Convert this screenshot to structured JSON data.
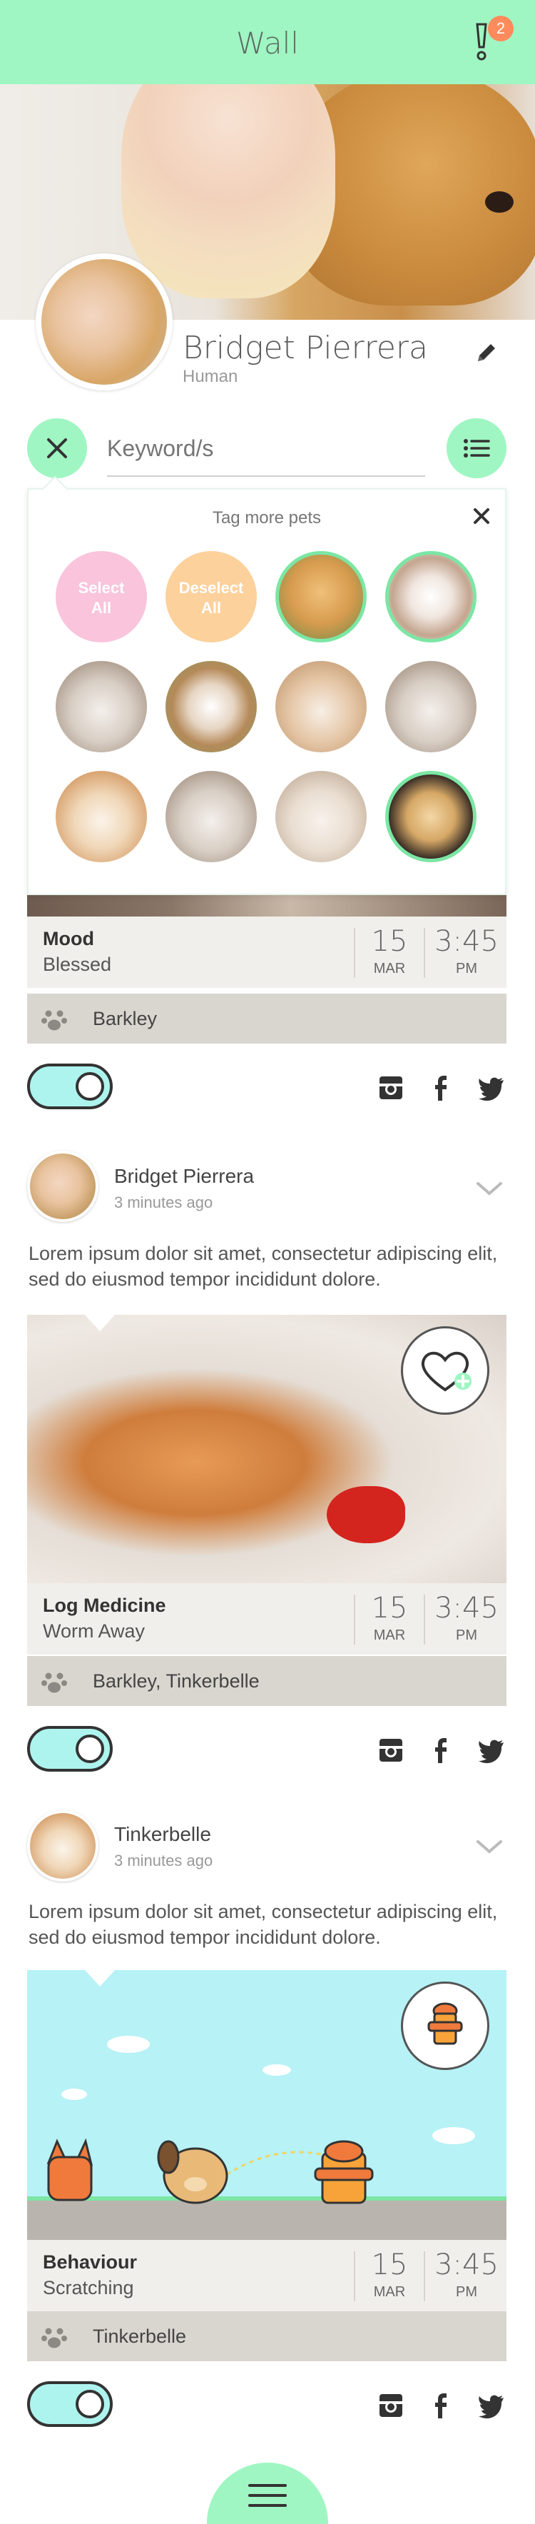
{
  "header": {
    "title": "Wall",
    "alert_count": "2"
  },
  "profile": {
    "name": "Bridget Pierrera",
    "role": "Human"
  },
  "search": {
    "placeholder": "Keyword/s"
  },
  "tag_panel": {
    "title": "Tag more pets",
    "select_all": [
      "Select",
      "All"
    ],
    "deselect_all": [
      "Deselect",
      "All"
    ]
  },
  "post1": {
    "info": {
      "label": "Mood",
      "value": "Blessed",
      "day": "15",
      "month": "MAR",
      "time": "3:45",
      "ampm": "PM"
    },
    "pets": "Barkley"
  },
  "post2": {
    "author": "Bridget Pierrera",
    "time_ago": "3 minutes ago",
    "text": "Lorem ipsum dolor sit amet, consectetur adipiscing elit, sed do eiusmod tempor incididunt dolore.",
    "info": {
      "label": "Log Medicine",
      "value": "Worm Away",
      "day": "15",
      "month": "MAR",
      "time": "3:45",
      "ampm": "PM"
    },
    "pets": "Barkley, Tinkerbelle"
  },
  "post3": {
    "author": "Tinkerbelle",
    "time_ago": "3 minutes ago",
    "text": "Lorem ipsum dolor sit amet, consectetur adipiscing elit, sed do eiusmod tempor incididunt dolore.",
    "info": {
      "label": "Behaviour",
      "value": "Scratching",
      "day": "15",
      "month": "MAR",
      "time": "3:45",
      "ampm": "PM"
    },
    "pets": "Tinkerbelle"
  },
  "colors": {
    "mint": "#9ff6c2",
    "toggle": "#aef4ee",
    "select_pink": "#f9c4dc",
    "deselect_orange": "#fdd19c",
    "badge": "#ff8a5c"
  }
}
